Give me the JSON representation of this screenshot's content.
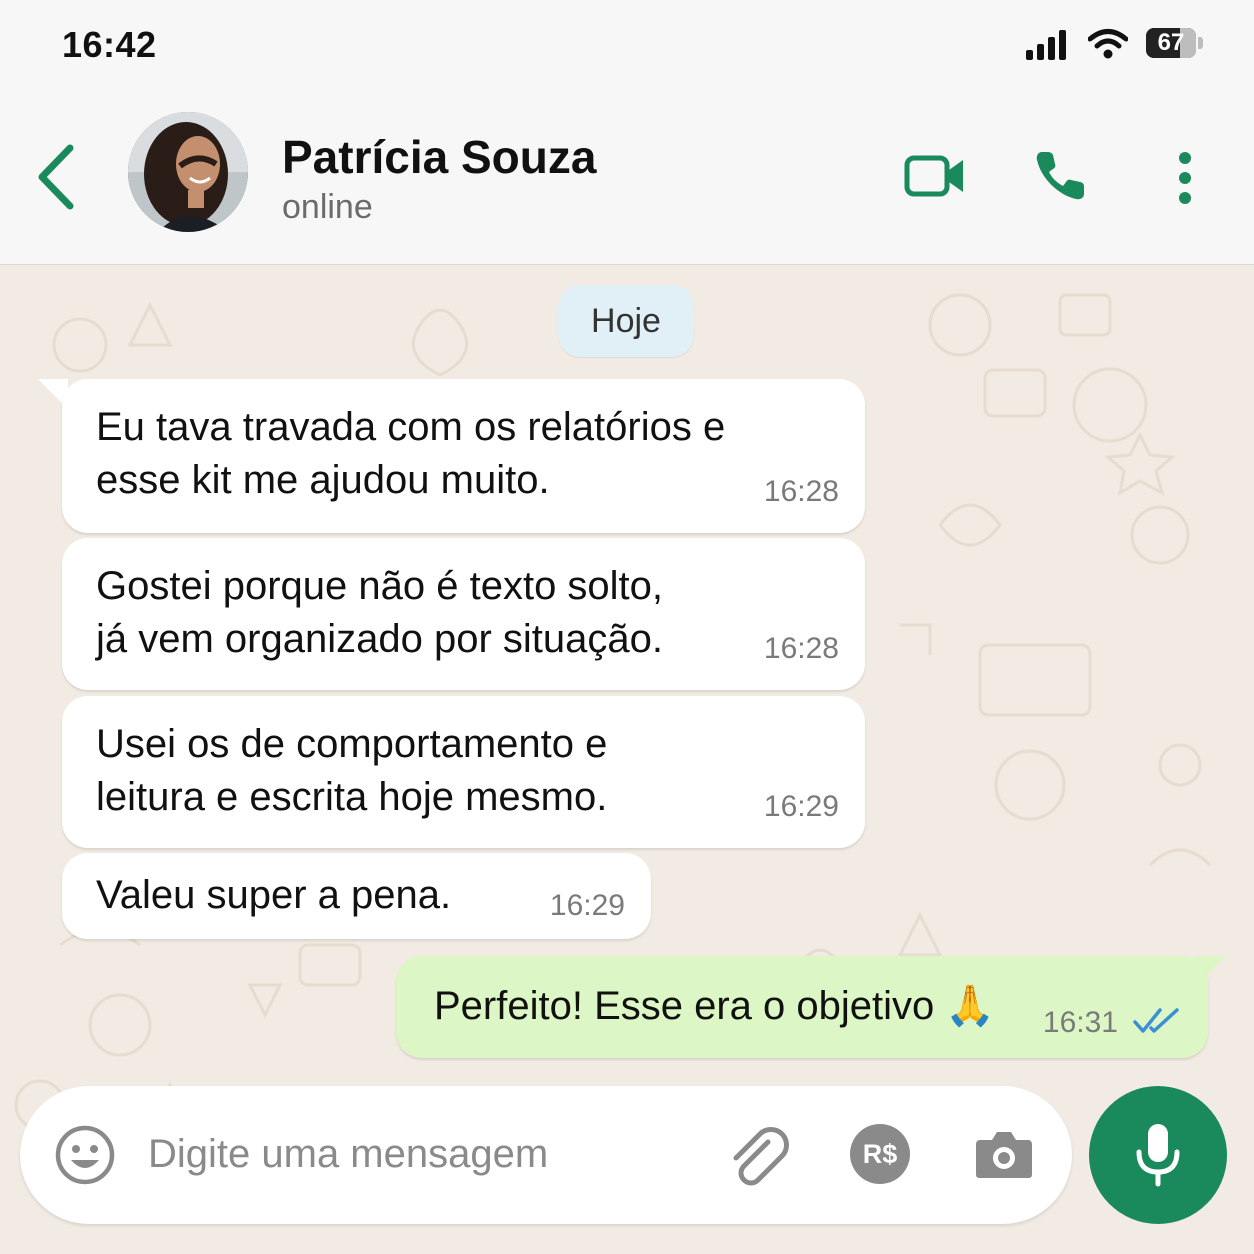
{
  "status_bar": {
    "time": "16:42",
    "battery": "67",
    "battery_level": 0.67
  },
  "header": {
    "contact_name": "Patrícia Souza",
    "presence": "online",
    "icons": [
      "back-arrow-icon",
      "video-call-icon",
      "phone-icon",
      "more-options-icon"
    ]
  },
  "chat": {
    "day_label": "Hoje",
    "messages": [
      {
        "direction": "in",
        "text": "Eu tava travada com os relatórios e\nesse kit me ajudou muito.",
        "time": "16:28"
      },
      {
        "direction": "in",
        "text": "Gostei porque não é texto solto,\njá vem organizado por situação.",
        "time": "16:28"
      },
      {
        "direction": "in",
        "text": "Usei os de comportamento e\nleitura e escrita hoje mesmo.",
        "time": "16:29"
      },
      {
        "direction": "in",
        "text": "Valeu super a pena.",
        "time": "16:29"
      },
      {
        "direction": "out",
        "text": "Perfeito! Esse era o objetivo 🙏",
        "time": "16:31",
        "status": "read"
      }
    ]
  },
  "input": {
    "placeholder": "Digite uma mensagem",
    "payment_label": "R$",
    "icons": [
      "emoji-icon",
      "attach-icon",
      "payment-icon",
      "camera-icon",
      "microphone-icon"
    ]
  },
  "colors": {
    "accent": "#1a8a5c",
    "outgoing_bubble": "#dcf7c5",
    "incoming_bubble": "#ffffff",
    "chat_background": "#f2ebe3",
    "read_ticks": "#3b8fd6"
  }
}
